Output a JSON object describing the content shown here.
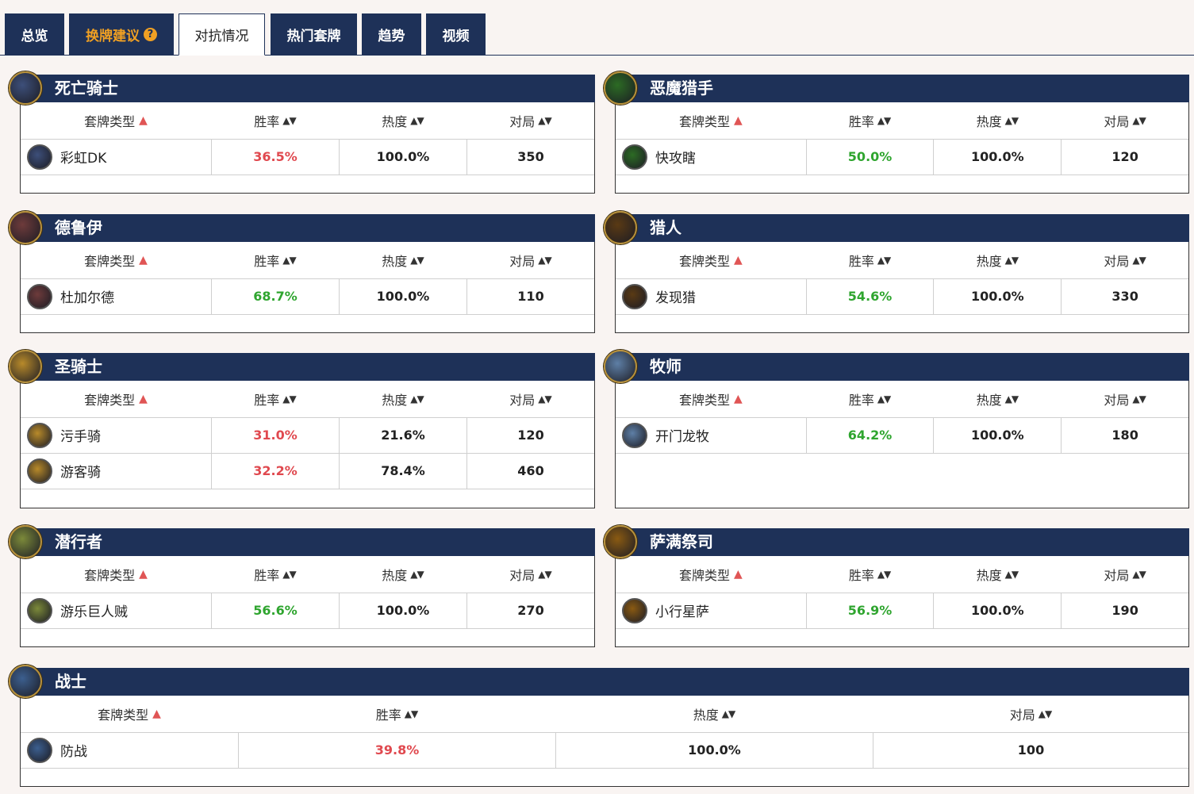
{
  "tabs": [
    {
      "label": "总览",
      "state": "normal"
    },
    {
      "label": "换牌建议",
      "state": "orange"
    },
    {
      "label": "对抗情况",
      "state": "active"
    },
    {
      "label": "热门套牌",
      "state": "normal"
    },
    {
      "label": "趋势",
      "state": "normal"
    },
    {
      "label": "视频",
      "state": "normal"
    }
  ],
  "columns": {
    "deck_type": "套牌类型",
    "winrate": "胜率",
    "popularity": "热度",
    "games": "对局"
  },
  "colors": {
    "header_bg": "#1e3158",
    "win_red": "#e0494f",
    "win_green": "#2fa52f",
    "tab_orange": "#f0a023"
  },
  "panels": [
    {
      "name": "死亡骑士",
      "icon": "death-knight-class-icon",
      "color": "#3d4f7a",
      "rows": [
        {
          "deck": "彩虹DK",
          "winrate": "36.5%",
          "trend": "red",
          "popularity": "100.0%",
          "games": "350"
        }
      ]
    },
    {
      "name": "恶魔猎手",
      "icon": "demon-hunter-class-icon",
      "color": "#2c6b24",
      "rows": [
        {
          "deck": "快攻瞎",
          "winrate": "50.0%",
          "trend": "green",
          "popularity": "100.0%",
          "games": "120"
        }
      ]
    },
    {
      "name": "德鲁伊",
      "icon": "druid-class-icon",
      "color": "#6e3b3b",
      "rows": [
        {
          "deck": "杜加尔德",
          "winrate": "68.7%",
          "trend": "green",
          "popularity": "100.0%",
          "games": "110"
        }
      ]
    },
    {
      "name": "猎人",
      "icon": "hunter-class-icon",
      "color": "#5a3a14",
      "rows": [
        {
          "deck": "发现猎",
          "winrate": "54.6%",
          "trend": "green",
          "popularity": "100.0%",
          "games": "330"
        }
      ]
    },
    {
      "name": "圣骑士",
      "icon": "paladin-class-icon",
      "color": "#b88a2a",
      "rows": [
        {
          "deck": "污手骑",
          "winrate": "31.0%",
          "trend": "red",
          "popularity": "21.6%",
          "games": "120"
        },
        {
          "deck": "游客骑",
          "winrate": "32.2%",
          "trend": "red",
          "popularity": "78.4%",
          "games": "460"
        }
      ]
    },
    {
      "name": "牧师",
      "icon": "priest-class-icon",
      "color": "#5e7fa6",
      "rows": [
        {
          "deck": "开门龙牧",
          "winrate": "64.2%",
          "trend": "green",
          "popularity": "100.0%",
          "games": "180"
        }
      ]
    },
    {
      "name": "潜行者",
      "icon": "rogue-class-icon",
      "color": "#7c8a3a",
      "rows": [
        {
          "deck": "游乐巨人贼",
          "winrate": "56.6%",
          "trend": "green",
          "popularity": "100.0%",
          "games": "270"
        }
      ]
    },
    {
      "name": "萨满祭司",
      "icon": "shaman-class-icon",
      "color": "#8a5a12",
      "rows": [
        {
          "deck": "小行星萨",
          "winrate": "56.9%",
          "trend": "green",
          "popularity": "100.0%",
          "games": "190"
        }
      ]
    },
    {
      "name": "战士",
      "icon": "warrior-class-icon",
      "color": "#3c5f8f",
      "rows": [
        {
          "deck": "防战",
          "winrate": "39.8%",
          "trend": "red",
          "popularity": "100.0%",
          "games": "100"
        }
      ]
    }
  ]
}
